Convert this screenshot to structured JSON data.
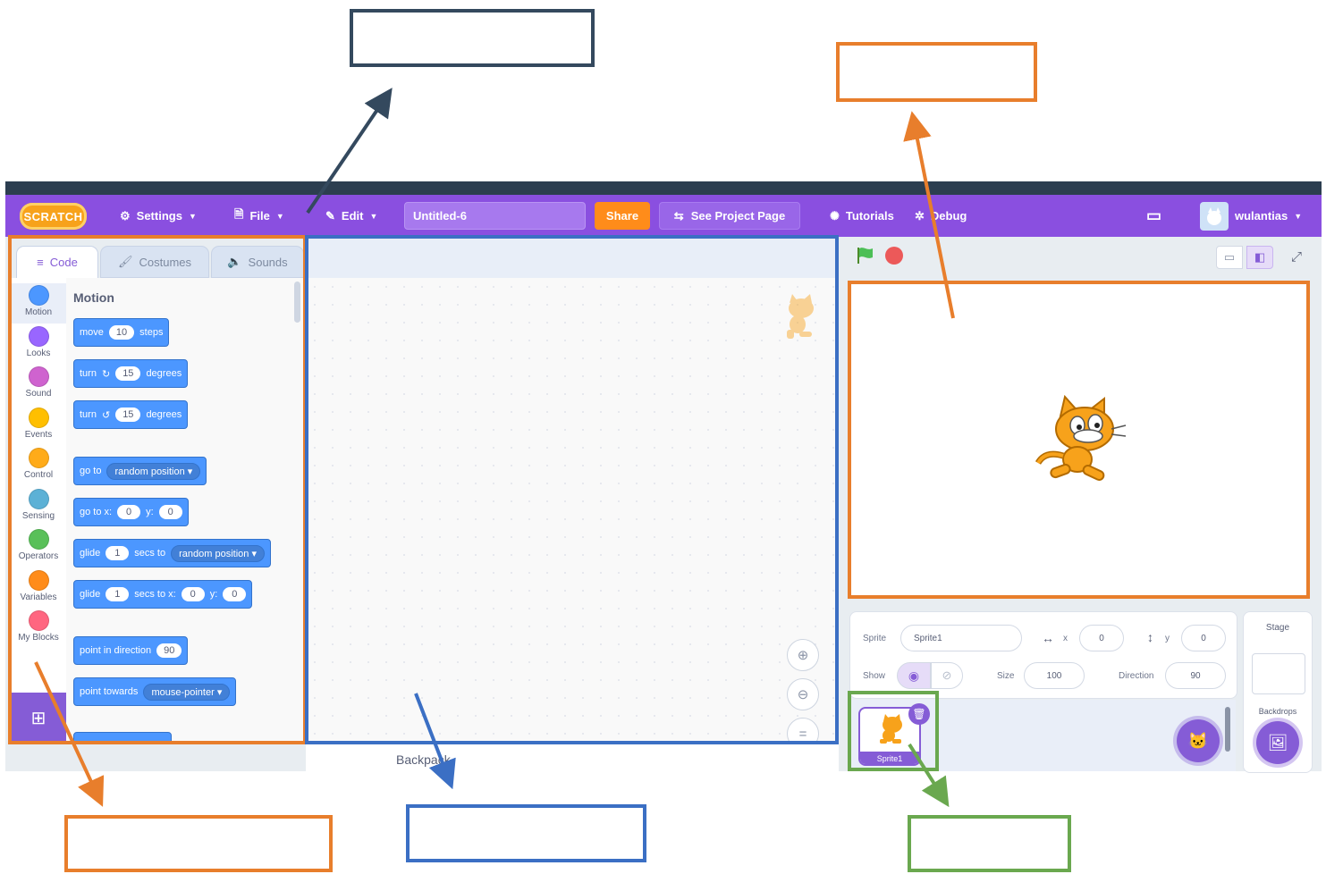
{
  "menubar": {
    "logo": "SCRATCH",
    "settings": "Settings",
    "file": "File",
    "edit": "Edit",
    "project_title": "Untitled-6",
    "share": "Share",
    "see_project_page": "See Project Page",
    "tutorials": "Tutorials",
    "debug": "Debug",
    "username": "wulantias"
  },
  "tabs": [
    "Code",
    "Costumes",
    "Sounds"
  ],
  "categories": [
    {
      "label": "Motion",
      "color": "#4c97ff"
    },
    {
      "label": "Looks",
      "color": "#9966ff"
    },
    {
      "label": "Sound",
      "color": "#cf63cf"
    },
    {
      "label": "Events",
      "color": "#ffbf00"
    },
    {
      "label": "Control",
      "color": "#ffab19"
    },
    {
      "label": "Sensing",
      "color": "#5cb1d6"
    },
    {
      "label": "Operators",
      "color": "#59c059"
    },
    {
      "label": "Variables",
      "color": "#ff8c1a"
    },
    {
      "label": "My Blocks",
      "color": "#ff6680"
    }
  ],
  "palette": {
    "title": "Motion",
    "move": {
      "a": "move",
      "v": "10",
      "b": "steps"
    },
    "turn_right": {
      "a": "turn",
      "v": "15",
      "b": "degrees"
    },
    "turn_left": {
      "a": "turn",
      "v": "15",
      "b": "degrees"
    },
    "goto": {
      "a": "go to",
      "dd": "random position"
    },
    "goto_xy": {
      "a": "go to x:",
      "x": "0",
      "b": "y:",
      "y": "0"
    },
    "glide_to": {
      "a": "glide",
      "v": "1",
      "b": "secs to",
      "dd": "random position"
    },
    "glide_xy": {
      "a": "glide",
      "v": "1",
      "b": "secs to x:",
      "x": "0",
      "c": "y:",
      "y": "0"
    },
    "point_dir": {
      "a": "point in direction",
      "v": "90"
    },
    "point_towards": {
      "a": "point towards",
      "dd": "mouse-pointer"
    }
  },
  "backpack": "Backpack",
  "sprite_info": {
    "sprite_label": "Sprite",
    "sprite_name": "Sprite1",
    "x_label": "x",
    "x": "0",
    "y_label": "y",
    "y": "0",
    "show_label": "Show",
    "size_label": "Size",
    "size": "100",
    "direction_label": "Direction",
    "direction": "90"
  },
  "sprite_thumb": "Sprite1",
  "stage_panel": {
    "title": "Stage",
    "backdrops": "Backdrops"
  },
  "colors": {
    "menubar": "#8a4fe0",
    "share": "#ff8c1a",
    "motion": "#4c97ff",
    "anno_orange": "#e87e2c",
    "anno_blue": "#3b6fc4",
    "anno_green": "#6aa84f",
    "anno_navy": "#34495e"
  }
}
